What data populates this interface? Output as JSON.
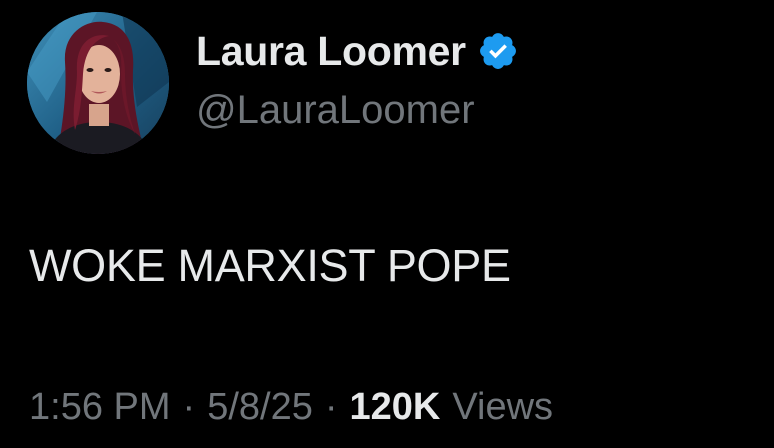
{
  "author": {
    "display_name": "Laura Loomer",
    "handle": "@LauraLoomer",
    "verified_icon": "verified-badge-icon",
    "verified_color": "#1d9bf0"
  },
  "tweet": {
    "text": "WOKE MARXIST POPE"
  },
  "meta": {
    "time": "1:56 PM",
    "separator": "·",
    "date": "5/8/25",
    "views_count": "120K",
    "views_label": "Views"
  },
  "colors": {
    "background": "#000000",
    "primary_text": "#e7e9ea",
    "secondary_text": "#71767b"
  }
}
